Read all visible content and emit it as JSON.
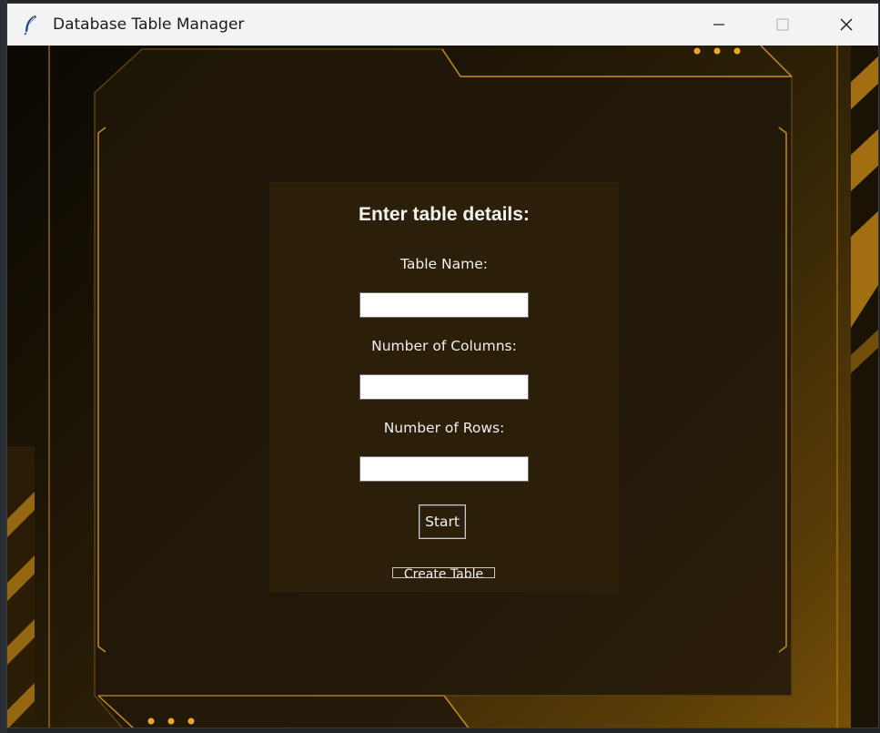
{
  "window": {
    "title": "Database Table Manager",
    "app_icon": "feather-icon",
    "controls": [
      "minimize-icon",
      "maximize-icon",
      "close-icon"
    ]
  },
  "form": {
    "heading": "Enter table details:",
    "table_name_label": "Table Name:",
    "table_name_value": "",
    "columns_label": "Number of Columns:",
    "columns_value": "",
    "rows_label": "Number of Rows:",
    "rows_value": "",
    "start_label": "Start",
    "create_label": "Create Table"
  },
  "colors": {
    "accent_gold": "#f0a62a",
    "panel_bg": "#2b1f09",
    "text": "#f2f2f2"
  }
}
